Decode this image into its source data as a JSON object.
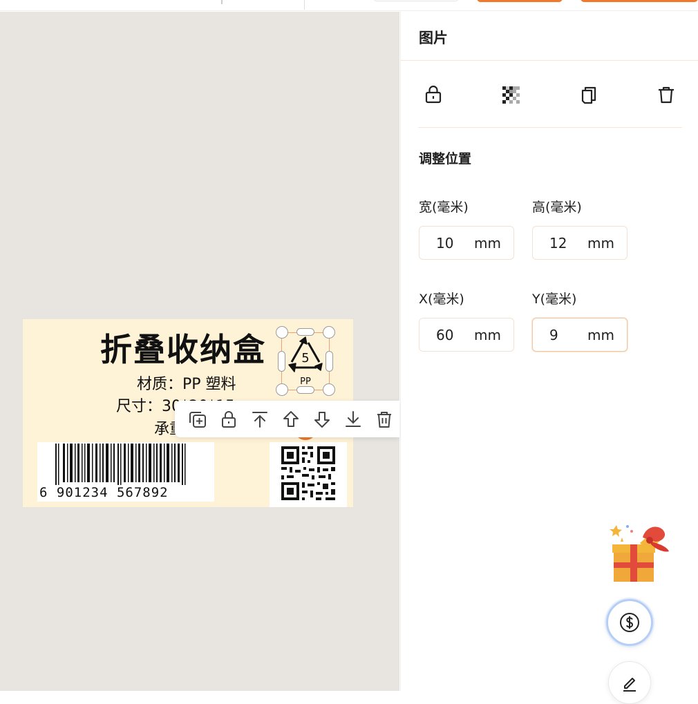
{
  "label": {
    "title": "折叠收纳盒",
    "line1": "材质：PP 塑料",
    "line2": "尺寸：30*20*15",
    "line3": "承重：",
    "barcode_digits": "6 901234 567892",
    "recycle_number": "5",
    "recycle_text": "PP"
  },
  "toolbar": {
    "items": [
      "duplicate-icon",
      "lock-icon",
      "bring-to-front-icon",
      "move-up-icon",
      "move-down-icon",
      "send-to-back-icon",
      "trash-icon"
    ]
  },
  "panel": {
    "title": "图片",
    "actions": [
      "lock-icon",
      "transparency-icon",
      "copy-icon",
      "trash-icon"
    ],
    "section_title": "调整位置",
    "width_label": "宽(毫米)",
    "height_label": "高(毫米)",
    "x_label": "X(毫米)",
    "y_label": "Y(毫米)",
    "width_value": "10",
    "height_value": "12",
    "x_value": "60",
    "y_value": "9",
    "unit": "mm"
  },
  "colors": {
    "accent": "#f0792c",
    "canvas_bg": "#e8e5e1",
    "label_bg": "#fef2d7",
    "focus_ring": "#b6cdf5"
  }
}
